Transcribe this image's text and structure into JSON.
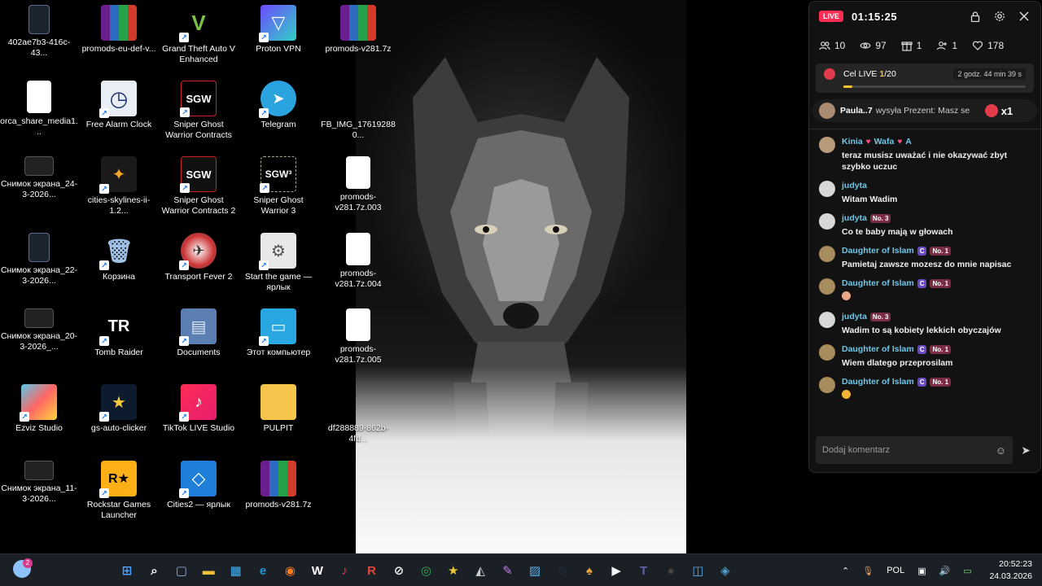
{
  "desktop": {
    "icons": [
      {
        "label": "402ae7b3-416c-43...",
        "kind": "phone"
      },
      {
        "label": "promods-eu-def-v...",
        "kind": "rar"
      },
      {
        "label": "Grand Theft Auto V Enhanced",
        "kind": "gta",
        "glyph": "V"
      },
      {
        "label": "Proton VPN",
        "kind": "proton",
        "glyph": "▽"
      },
      {
        "label": "promods-v281.7z",
        "kind": "rar"
      },
      {
        "label": "orca_share_media1...",
        "kind": "file"
      },
      {
        "label": "Free Alarm Clock",
        "kind": "clock",
        "glyph": "◷"
      },
      {
        "label": "Sniper Ghost Warrior Contracts",
        "kind": "sgw",
        "glyph": "SGW"
      },
      {
        "label": "Telegram",
        "kind": "telegram",
        "glyph": "➤"
      },
      {
        "label": "FB_IMG_176192880...",
        "kind": "photo"
      },
      {
        "label": "Снимок экрана_24-3-2026...",
        "kind": "sshot"
      },
      {
        "label": "cities-skylines-ii-1.2...",
        "kind": "rocket",
        "glyph": "✦"
      },
      {
        "label": "Sniper Ghost Warrior Contracts 2",
        "kind": "sgw2",
        "glyph": "SGW"
      },
      {
        "label": "Sniper Ghost Warrior 3",
        "kind": "sgw3",
        "glyph": "SGW³"
      },
      {
        "label": "promods-v281.7z.003",
        "kind": "file"
      },
      {
        "label": "Снимок экрана_22-3-2026...",
        "kind": "phone"
      },
      {
        "label": "Корзина",
        "kind": "bin",
        "glyph": "🗑"
      },
      {
        "label": "Transport Fever 2",
        "kind": "tf2",
        "glyph": "✈"
      },
      {
        "label": "Start the game — ярлык",
        "kind": "gear",
        "glyph": "⚙"
      },
      {
        "label": "promods-v281.7z.004",
        "kind": "file"
      },
      {
        "label": "Снимок экрана_20-3-2026_...",
        "kind": "sshot"
      },
      {
        "label": "Tomb Raider",
        "kind": "tr",
        "glyph": "TR"
      },
      {
        "label": "Documents",
        "kind": "folder",
        "glyph": "▤"
      },
      {
        "label": "Этот компьютер",
        "kind": "pc",
        "glyph": "▭"
      },
      {
        "label": "promods-v281.7z.005",
        "kind": "file"
      },
      {
        "label": "Ezviz Studio",
        "kind": "ezviz"
      },
      {
        "label": "gs-auto-clicker",
        "kind": "star",
        "glyph": "★"
      },
      {
        "label": "TikTok LIVE Studio",
        "kind": "tiktok",
        "glyph": "♪"
      },
      {
        "label": "PULPIT",
        "kind": "folderY"
      },
      {
        "label": "df288889-862b-4fd...",
        "kind": "photo"
      },
      {
        "label": "Снимок экрана_11-3-2026...",
        "kind": "sshot"
      },
      {
        "label": "Rockstar Games Launcher",
        "kind": "rockstar",
        "glyph": "R★"
      },
      {
        "label": "Cities2 — ярлык",
        "kind": "cities2",
        "glyph": "◇"
      },
      {
        "label": "promods-v281.7z",
        "kind": "rar"
      }
    ]
  },
  "live": {
    "badge": "LIVE",
    "timer": "01:15:25",
    "stats": {
      "viewers": "10",
      "views": "97",
      "gifts": "1",
      "follows": "1",
      "likes": "178"
    },
    "goal": {
      "prefix": "Cel LIVE ",
      "current": "1",
      "total": "/20",
      "time_left": "2 godz. 44 min 39 s",
      "progress": 0.05
    },
    "gift_banner": {
      "user": "Paula..7",
      "text": "wysyła Prezent: Masz se",
      "multiplier": "x1"
    },
    "chat": [
      {
        "user": "Kinia",
        "user2": "Wafa",
        "user3": "A",
        "text": "teraz musisz uważać i nie okazywać zbyt szybko uczuc",
        "avatar": "kinia"
      },
      {
        "user": "judyta",
        "text": "Witam Wadim",
        "avatar": "judyta"
      },
      {
        "user": "judyta",
        "level": "No. 3",
        "text": "Co te baby mają w głowach",
        "avatar": "judyta"
      },
      {
        "user": "Daughter of Islam",
        "sub": "C",
        "level": "No. 1",
        "text": "Pamietaj zawsze mozesz do mnie napisac",
        "avatar": "daughter"
      },
      {
        "user": "Daughter of Islam",
        "sub": "C",
        "level": "No. 1",
        "text": "",
        "avatar": "daughter"
      },
      {
        "user": "judyta",
        "level": "No. 3",
        "text": "Wadim to są kobiety lekkich obyczajów",
        "avatar": "judyta"
      },
      {
        "user": "Daughter of Islam",
        "sub": "C",
        "level": "No. 1",
        "text": "Wiem dlatego przeprosilam",
        "avatar": "daughter"
      },
      {
        "user": "Daughter of Islam",
        "sub": "C",
        "level": "No. 1",
        "text": "",
        "avatar": "daughter"
      }
    ],
    "composer_placeholder": "Dodaj komentarz"
  },
  "taskbar": {
    "weather_badge": "2",
    "language": "POL",
    "time": "20:52:23",
    "date": "24.03.2026",
    "apps": [
      "start-icon",
      "search-icon",
      "task-view-icon",
      "file-explorer-icon",
      "photos-icon",
      "edge-icon",
      "firefox-icon",
      "wd-icon",
      "tiktok-icon",
      "r-icon",
      "compass-icon",
      "chrome-icon",
      "star-icon",
      "teacher-icon",
      "palette-icon",
      "gallery-icon",
      "steam-icon",
      "game-icon",
      "media-player-icon",
      "teams-icon",
      "obs-icon",
      "window-icon",
      "edge-beta-icon"
    ]
  }
}
